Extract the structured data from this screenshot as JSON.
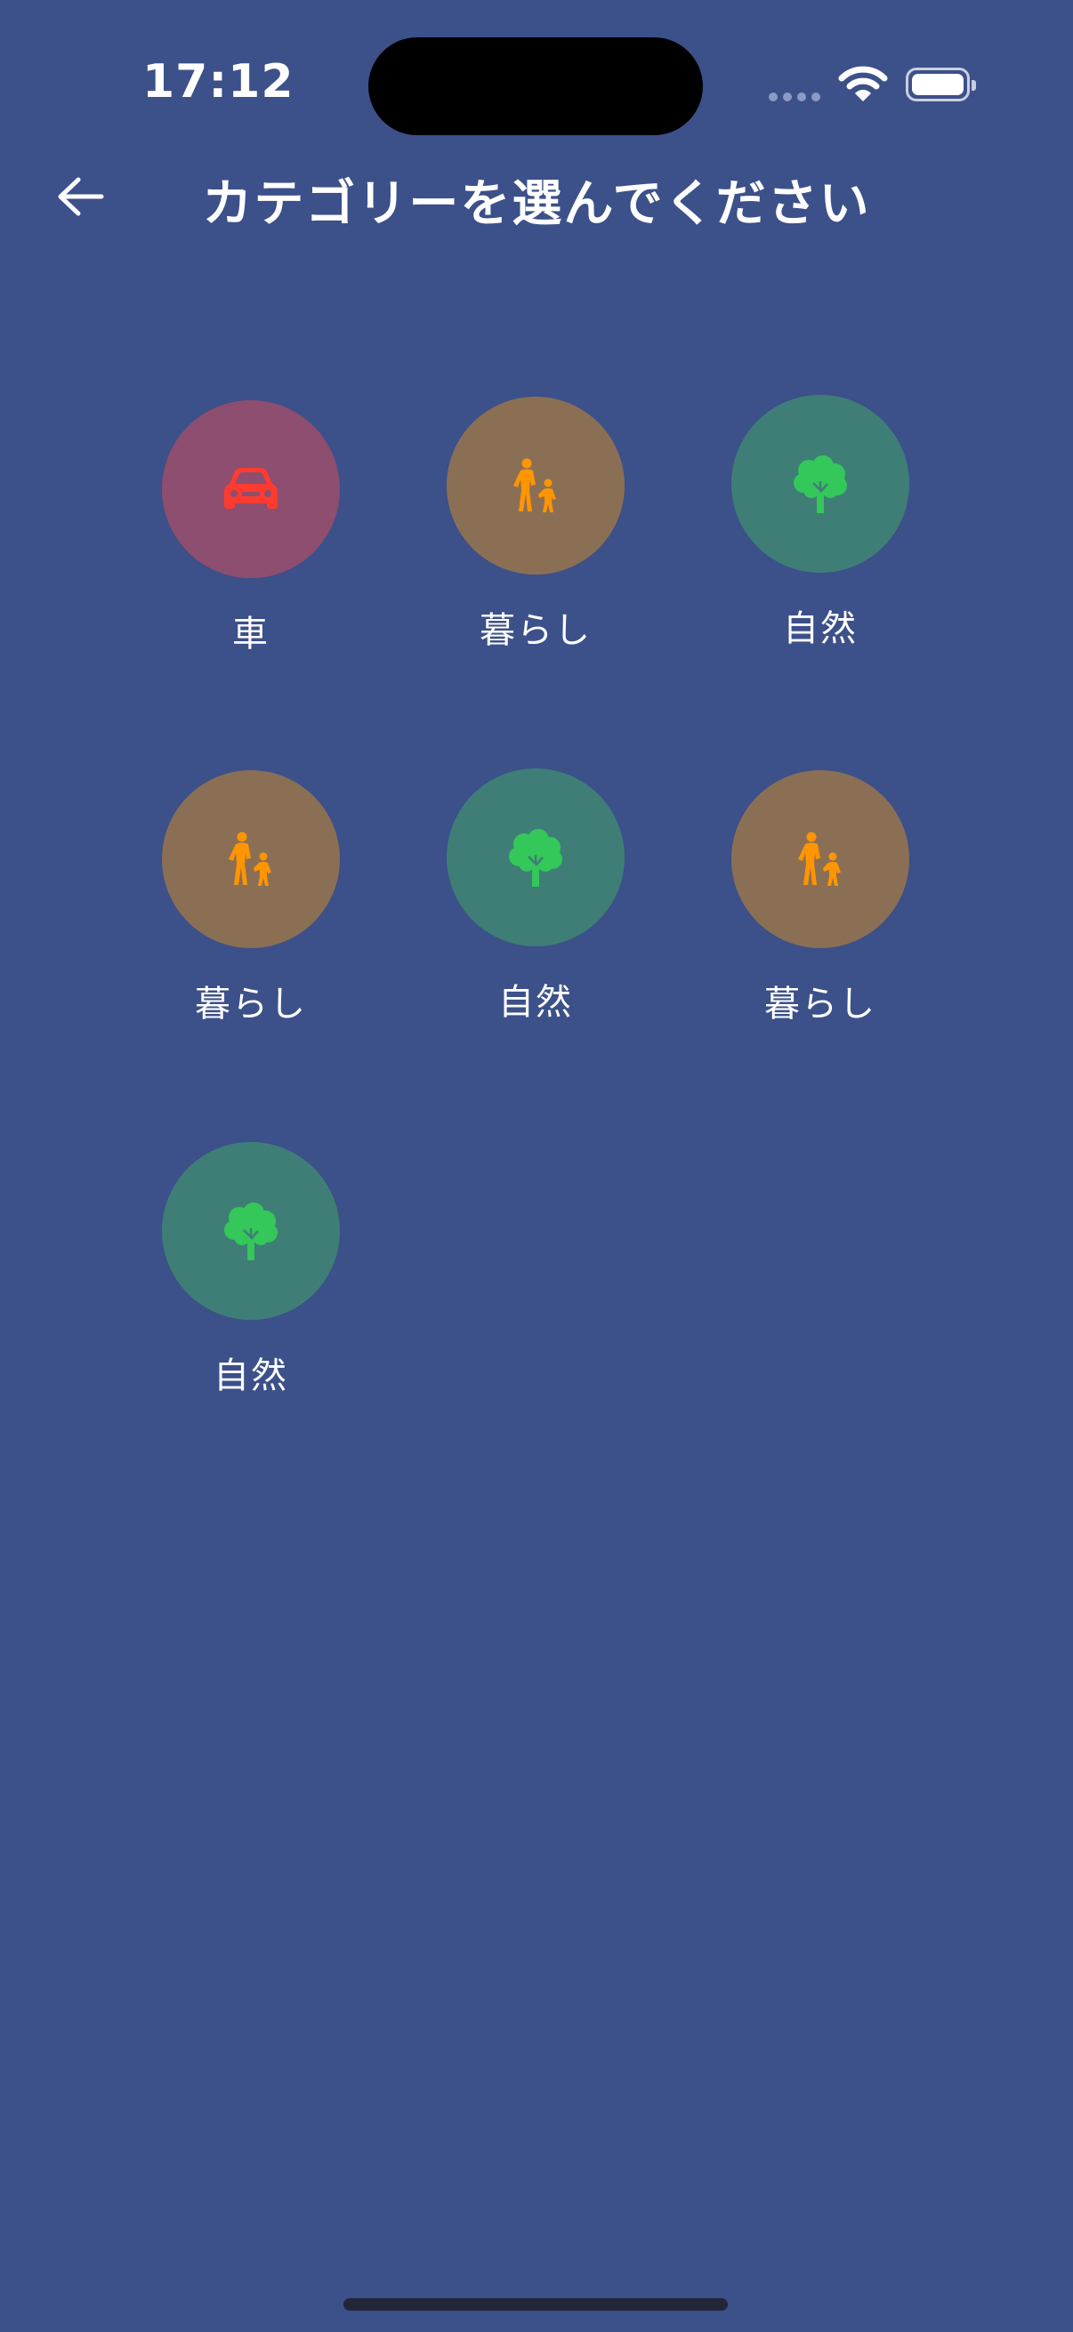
{
  "status_bar": {
    "time": "17:12"
  },
  "header": {
    "title": "カテゴリーを選んでください"
  },
  "categories": [
    {
      "label": "車",
      "icon": "car-icon",
      "color": "#FF3B30",
      "bg": "#8D4E6F"
    },
    {
      "label": "暮らし",
      "icon": "family-icon",
      "color": "#FF9500",
      "bg": "#8B6F55"
    },
    {
      "label": "自然",
      "icon": "tree-icon",
      "color": "#34C759",
      "bg": "#3E7E77"
    },
    {
      "label": "暮らし",
      "icon": "family-icon",
      "color": "#FF9500",
      "bg": "#8B6F55"
    },
    {
      "label": "自然",
      "icon": "tree-icon",
      "color": "#34C759",
      "bg": "#3E7E77"
    },
    {
      "label": "暮らし",
      "icon": "family-icon",
      "color": "#FF9500",
      "bg": "#8B6F55"
    },
    {
      "label": "自然",
      "icon": "tree-icon",
      "color": "#34C759",
      "bg": "#3E7E77"
    }
  ],
  "colors": {
    "background": "#3C5089",
    "text": "#FFFFFF"
  }
}
